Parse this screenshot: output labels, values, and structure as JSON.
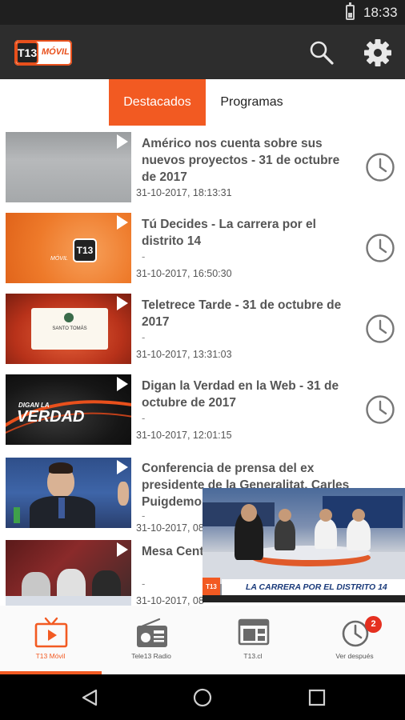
{
  "status_bar": {
    "time": "18:33"
  },
  "app_bar": {
    "logo_text": "T13",
    "logo_subtitle": "MÓVIL",
    "search_icon": "search-icon",
    "settings_icon": "gear-icon"
  },
  "tabs": [
    {
      "label": "Destacados",
      "active": true
    },
    {
      "label": "Programas",
      "active": false
    }
  ],
  "videos": [
    {
      "title": "Américo nos cuenta sobre sus nuevos proyectos - 31 de octubre de 2017",
      "subtitle": "-",
      "date": "31-10-2017, 18:13:31"
    },
    {
      "title": "Tú Decides - La carrera por el distrito 14",
      "subtitle": "-",
      "date": "31-10-2017, 16:50:30",
      "thumb_logo": "T13",
      "thumb_logo_subtitle": "MÓVIL"
    },
    {
      "title": "Teletrece Tarde - 31 de octubre de 2017",
      "subtitle": "-",
      "date": "31-10-2017, 13:31:03",
      "thumb_caption": "SANTO TOMÁS"
    },
    {
      "title": "Digan la Verdad en la Web - 31 de octubre de 2017",
      "subtitle": "-",
      "date": "31-10-2017, 12:01:15",
      "thumb_caption_line1": "DIGAN LA",
      "thumb_caption_line2": "VERDAD"
    },
    {
      "title": "Conferencia de prensa del ex presidente de la Generalitat, Carles Puigdemont",
      "subtitle": "-",
      "date": "31-10-2017, 08"
    },
    {
      "title": "Mesa Centr",
      "subtitle": "-",
      "date": "31-10-2017, 08"
    }
  ],
  "pip_player": {
    "caption": "LA CARRERA POR EL DISTRITO 14",
    "logo_text": "T13"
  },
  "bottom_nav": [
    {
      "label": "T13 Móvil",
      "icon": "tv-play-icon",
      "active": true
    },
    {
      "label": "Tele13 Radio",
      "icon": "radio-icon",
      "active": false
    },
    {
      "label": "T13.cl",
      "icon": "browser-window-icon",
      "active": false
    },
    {
      "label": "Ver después",
      "icon": "clock-icon",
      "active": false,
      "badge": "2"
    }
  ],
  "system_nav": {
    "back_icon": "back-triangle-icon",
    "home_icon": "home-circle-icon",
    "recents_icon": "recents-square-icon"
  },
  "colors": {
    "accent": "#f25a22",
    "app_bar": "#2d2d2d",
    "status_bar": "#1f1f1f",
    "title_text": "#555555",
    "badge": "#e53020"
  }
}
